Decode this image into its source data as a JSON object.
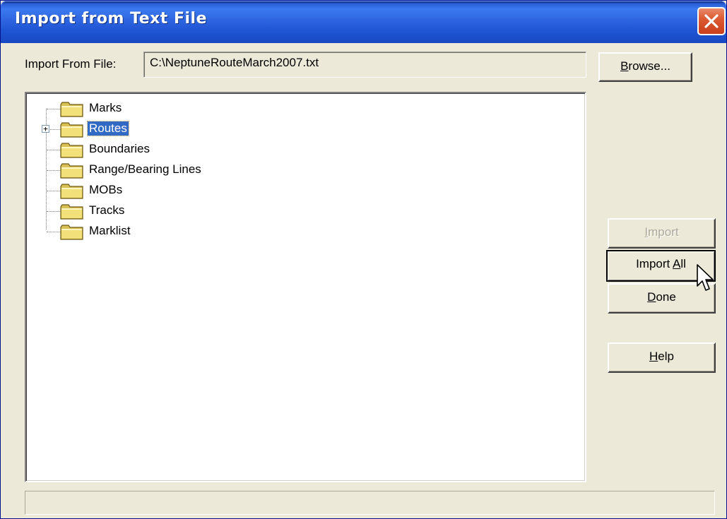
{
  "window": {
    "title": "Import from Text File"
  },
  "file": {
    "label_prefix": "Import From File:",
    "path": "C:\\NeptuneRouteMarch2007.txt"
  },
  "buttons": {
    "browse": {
      "mnemonic": "B",
      "rest": "rowse..."
    },
    "import": {
      "mnemonic": "I",
      "rest": "mport",
      "enabled": false
    },
    "import_all": {
      "prefix": "Import ",
      "mnemonic": "A",
      "rest": "ll"
    },
    "done": {
      "mnemonic": "D",
      "rest": "one"
    },
    "help": {
      "mnemonic": "H",
      "rest": "elp"
    }
  },
  "tree": {
    "items": [
      {
        "label": "Marks",
        "expandable": false,
        "selected": false
      },
      {
        "label": "Routes",
        "expandable": true,
        "expander": "+",
        "selected": true
      },
      {
        "label": "Boundaries",
        "expandable": false,
        "selected": false
      },
      {
        "label": "Range/Bearing Lines",
        "expandable": false,
        "selected": false
      },
      {
        "label": "MOBs",
        "expandable": false,
        "selected": false
      },
      {
        "label": "Tracks",
        "expandable": false,
        "selected": false
      },
      {
        "label": "Marklist",
        "expandable": false,
        "selected": false
      }
    ]
  },
  "status": {
    "text": ""
  },
  "colors": {
    "titlebar": "#2f66e0",
    "selection": "#316ac5",
    "folder": "#f2e07a",
    "dialog_bg": "#ece9d8"
  },
  "icons": {
    "close": "close-icon",
    "folder": "folder-icon",
    "cursor": "arrow-cursor-icon"
  }
}
